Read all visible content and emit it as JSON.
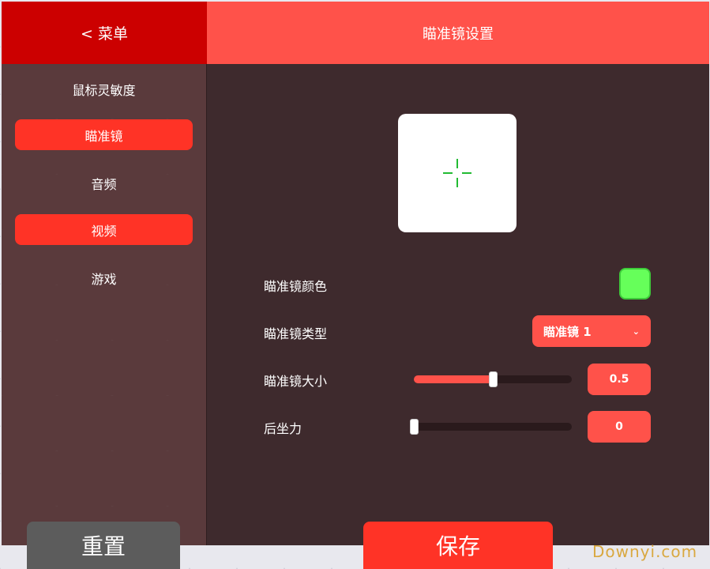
{
  "header": {
    "back_label": "< 菜单",
    "title": "瞄准镜设置"
  },
  "sidebar": {
    "items": [
      {
        "label": "鼠标灵敏度",
        "active": false
      },
      {
        "label": "瞄准镜",
        "active": true
      },
      {
        "label": "音频",
        "active": false
      },
      {
        "label": "视频",
        "active": true
      },
      {
        "label": "游戏",
        "active": false
      }
    ]
  },
  "settings": {
    "color_label": "瞄准镜颜色",
    "color_value": "#66ff5a",
    "type_label": "瞄准镜类型",
    "type_value": "瞄准镜 1",
    "size_label": "瞄准镜大小",
    "size_value": "0.5",
    "size_fraction": 0.5,
    "recoil_label": "后坐力",
    "recoil_value": "0",
    "recoil_fraction": 0
  },
  "buttons": {
    "reset_label": "重置",
    "save_label": "保存"
  },
  "watermark": "Downyi.com",
  "colors": {
    "accent": "#ff524a",
    "active": "#ff3326",
    "header_left": "#cc0000",
    "crosshair": "#22bb33"
  }
}
